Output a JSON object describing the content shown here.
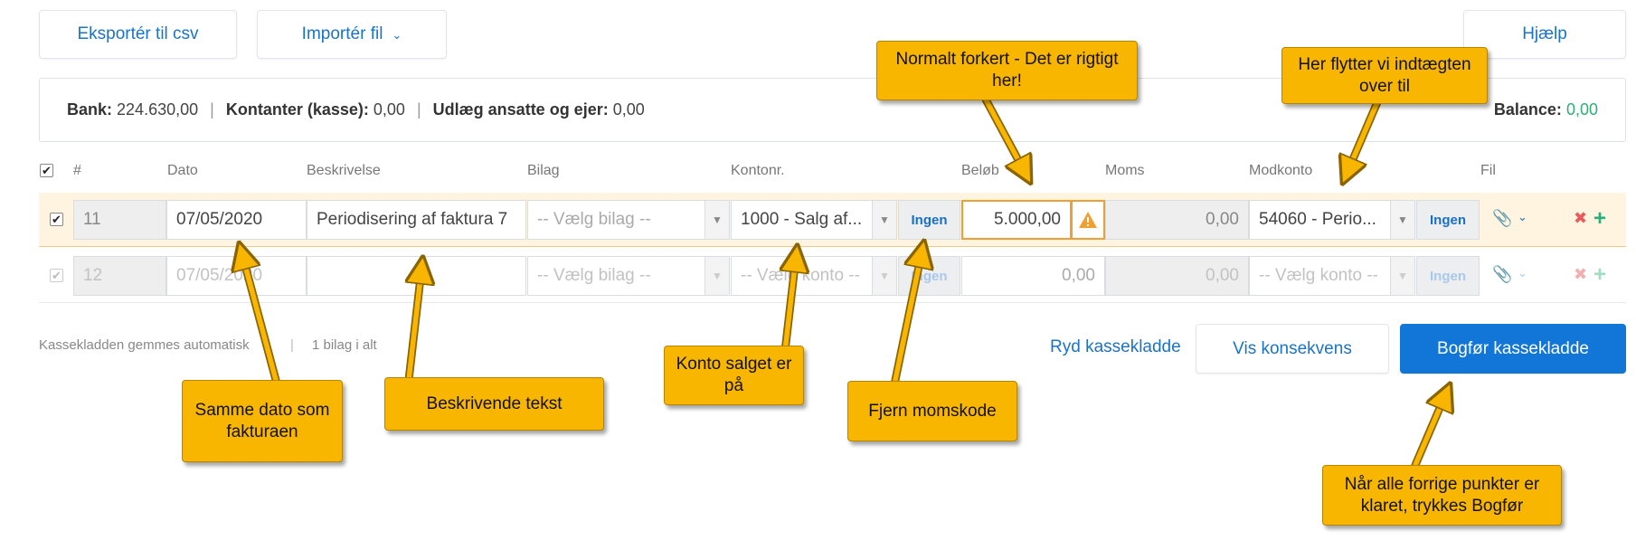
{
  "toolbar": {
    "export_label": "Eksportér til csv",
    "import_label": "Importér fil",
    "help_label": "Hjælp"
  },
  "summary": {
    "bank_label": "Bank:",
    "bank_value": "224.630,00",
    "cash_label": "Kontanter (kasse):",
    "cash_value": "0,00",
    "expense_label": "Udlæg ansatte og ejer:",
    "expense_value": "0,00",
    "balance_label": "Balance:",
    "balance_value": "0,00",
    "separator": "|"
  },
  "table": {
    "headers": {
      "num": "#",
      "date": "Dato",
      "description": "Beskrivelse",
      "voucher": "Bilag",
      "account": "Kontonr.",
      "amount": "Beløb",
      "vat": "Moms",
      "counter_account": "Modkonto",
      "file": "Fil"
    },
    "rows": [
      {
        "checked": "✔",
        "num": "11",
        "date": "07/05/2020",
        "description": "Periodisering af faktura 7",
        "voucher": "-- Vælg bilag --",
        "account": "1000 - Salg af...",
        "vat_code": "Ingen",
        "amount": "5.000,00",
        "vat": "0,00",
        "counter_account": "54060 - Perio...",
        "counter_vat_code": "Ingen"
      },
      {
        "checked": "✔",
        "num": "12",
        "date": "07/05/2020",
        "description": "",
        "voucher": "-- Vælg bilag --",
        "account": "-- Vælg konto --",
        "vat_code": "Ingen",
        "amount": "0,00",
        "vat": "0,00",
        "counter_account": "-- Vælg konto --",
        "counter_vat_code": "Ingen"
      }
    ]
  },
  "footer": {
    "autosave": "Kassekladden gemmes automatisk",
    "separator": "|",
    "voucher_count": "1 bilag i alt",
    "clear_label": "Ryd kassekladde",
    "consequence_label": "Vis konsekvens",
    "post_label": "Bogfør kassekladde"
  },
  "callouts": {
    "amount_note": "Normalt forkert - Det er rigtigt her!",
    "counter_note": "Her flytter vi indtægten over til",
    "date_note": "Samme dato som fakturaen",
    "description_note": "Beskrivende tekst",
    "account_note": "Konto salget er på",
    "vat_note": "Fjern momskode",
    "post_note": "Når alle forrige punkter er klaret, trykkes Bogfør"
  },
  "colors": {
    "accent": "#1176d8",
    "callout": "#f8b600",
    "balance": "#2eae74",
    "row_highlight": "#fff4e0",
    "delete": "#e85c5c",
    "add": "#27b07a"
  }
}
